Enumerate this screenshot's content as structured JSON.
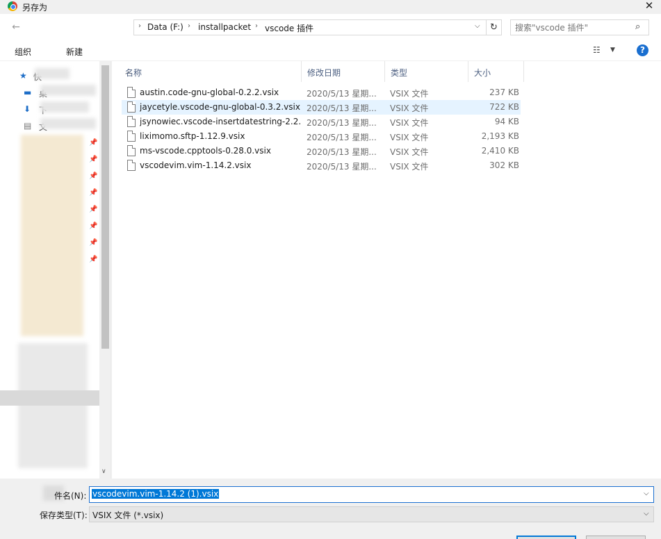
{
  "window": {
    "title": "另存为",
    "close_glyph": "✕"
  },
  "nav": {
    "back_glyph": "←",
    "breadcrumb": [
      "Data (F:)",
      "installpacket",
      "vscode 插件"
    ],
    "refresh_glyph": "↻",
    "search_placeholder": "搜索\"vscode 插件\""
  },
  "toolbar": {
    "organize": "组织",
    "new_folder": "新建",
    "help": "?"
  },
  "sidebar": {
    "quick_access": "快",
    "items": [
      "桌",
      "下",
      "文"
    ]
  },
  "columns": {
    "name": "名称",
    "date": "修改日期",
    "type": "类型",
    "size": "大小"
  },
  "files": [
    {
      "name": "austin.code-gnu-global-0.2.2.vsix",
      "date": "2020/5/13 星期...",
      "type": "VSIX 文件",
      "size": "237 KB"
    },
    {
      "name": "jaycetyle.vscode-gnu-global-0.3.2.vsix",
      "date": "2020/5/13 星期...",
      "type": "VSIX 文件",
      "size": "722 KB"
    },
    {
      "name": "jsynowiec.vscode-insertdatestring-2.2...",
      "date": "2020/5/13 星期...",
      "type": "VSIX 文件",
      "size": "94 KB"
    },
    {
      "name": "liximomo.sftp-1.12.9.vsix",
      "date": "2020/5/13 星期...",
      "type": "VSIX 文件",
      "size": "2,193 KB"
    },
    {
      "name": "ms-vscode.cpptools-0.28.0.vsix",
      "date": "2020/5/13 星期...",
      "type": "VSIX 文件",
      "size": "2,410 KB"
    },
    {
      "name": "vscodevim.vim-1.14.2.vsix",
      "date": "2020/5/13 星期...",
      "type": "VSIX 文件",
      "size": "302 KB"
    }
  ],
  "selected_index": 1,
  "bottom": {
    "filename_label": "件名(N):",
    "filename_value": "vscodevim.vim-1.14.2 (1).vsix",
    "filetype_label": "保存类型(T):",
    "filetype_value": "VSIX 文件 (*.vsix)"
  }
}
